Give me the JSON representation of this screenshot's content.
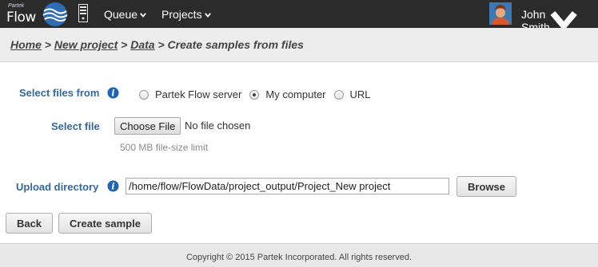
{
  "nav": {
    "logo_small": "Partek",
    "logo_text": "Flow",
    "queue_label": "Queue",
    "projects_label": "Projects",
    "user_name": "John Smith"
  },
  "breadcrumb": {
    "home": "Home",
    "new_project": "New project",
    "data": "Data",
    "sep": ">",
    "current": "Create samples from files"
  },
  "form": {
    "select_files_from_label": "Select files from",
    "source_options": [
      {
        "label": "Partek Flow server",
        "checked": false
      },
      {
        "label": "My computer",
        "checked": true
      },
      {
        "label": "URL",
        "checked": false
      }
    ],
    "select_file_label": "Select file",
    "choose_file_button": "Choose File",
    "file_status": "No file chosen",
    "size_limit_hint": "500 MB file-size limit",
    "upload_directory_label": "Upload directory",
    "upload_directory_value": "/home/flow/FlowData/project_output/Project_New project",
    "browse_button": "Browse"
  },
  "actions": {
    "back_button": "Back",
    "create_sample_button": "Create sample"
  },
  "footer": {
    "copyright": "Copyright © 2015 Partek Incorporated. All rights reserved."
  },
  "colors": {
    "navbar": "#2b2b2b",
    "label_blue": "#35689c",
    "info_icon_blue": "#1f63b4"
  },
  "icons": [
    "partek-flow-logo-icon",
    "server-icon",
    "chevron-down-icon",
    "avatar",
    "info-icon"
  ]
}
